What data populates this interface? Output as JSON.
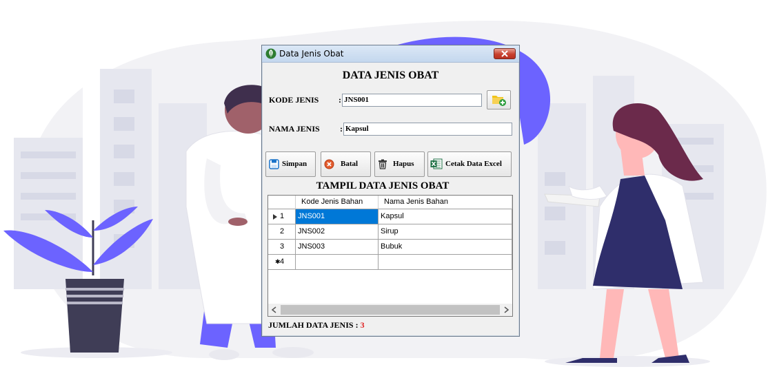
{
  "window": {
    "title": "Data Jenis Obat",
    "heading": "DATA JENIS OBAT"
  },
  "form": {
    "kode_label": "KODE JENIS",
    "kode_colon": ":",
    "kode_value": "JNS001",
    "nama_label": "NAMA JENIS",
    "nama_colon": ":",
    "nama_value": "Kapsul"
  },
  "buttons": {
    "simpan": "Simpan",
    "batal": "Batal",
    "hapus": "Hapus",
    "cetak": "Cetak Data Excel"
  },
  "table": {
    "title": "TAMPIL DATA JENIS OBAT",
    "columns": [
      "Kode Jenis Bahan",
      "Nama Jenis Bahan"
    ],
    "rows": [
      {
        "num": "1",
        "kode": "JNS001",
        "nama": "Kapsul"
      },
      {
        "num": "2",
        "kode": "JNS002",
        "nama": "Sirup"
      },
      {
        "num": "3",
        "kode": "JNS003",
        "nama": "Bubuk"
      }
    ],
    "new_row_num": "4",
    "selected_row": 0
  },
  "footer": {
    "label": "JUMLAH DATA JENIS : ",
    "count": "3"
  },
  "colors": {
    "accent_purple": "#6c63ff",
    "selection_blue": "#0078d7",
    "count_red": "#e02020"
  },
  "icons": {
    "title": "app-leaf-icon",
    "browse": "folder-add-icon",
    "simpan": "save-icon",
    "batal": "cancel-icon",
    "hapus": "trash-icon",
    "cetak": "excel-icon"
  }
}
